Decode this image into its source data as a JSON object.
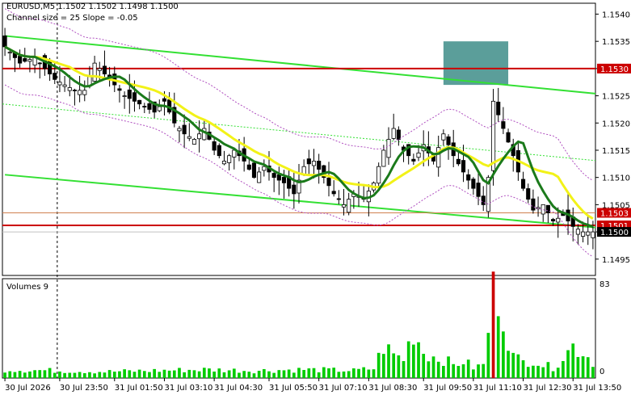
{
  "header": {
    "symbol_line": "EURUSD,M5  1.1502 1.1502 1.1498 1.1500",
    "channel_line": "Channel size = 25 Slope = -0.05"
  },
  "volume_panel": {
    "title": "Volumes 9",
    "scale_max": "83",
    "scale_min": "0"
  },
  "colors": {
    "background": "#ffffff",
    "candle": "#000000",
    "ma_fast": "#1b7a1b",
    "ma_slow": "#f2f218",
    "channel": "#33e033",
    "level_line": "#cc0000",
    "price_box": "#cc0000",
    "box_fill": "#5b9e9a",
    "volume_bar": "#00cc00",
    "volume_bar_hi": "#cc0000"
  },
  "chart_data": {
    "type": "candlestick",
    "symbol": "EURUSD",
    "timeframe": "M5",
    "ylim": [
      1.1492,
      1.1542
    ],
    "y_ticks": [
      "1.1540",
      "1.1535",
      "1.1530",
      "1.1525",
      "1.1520",
      "1.1515",
      "1.1510",
      "1.1505",
      "1.1500",
      "1.1495"
    ],
    "x_ticks": [
      "30 Jul 2026",
      "30 Jul 23:50",
      "31 Jul 01:50",
      "31 Jul 03:10",
      "31 Jul 04:30",
      "31 Jul 05:50",
      "31 Jul 07:10",
      "31 Jul 08:30",
      "31 Jul 09:50",
      "31 Jul 11:10",
      "31 Jul 12:30",
      "31 Jul 13:50"
    ],
    "price_labels": [
      {
        "text": "1.1530",
        "value": 1.153
      },
      {
        "text": "1.1503",
        "value": 1.15035
      },
      {
        "text": "1.1501",
        "value": 1.15012
      },
      {
        "text": "1.1500",
        "value": 1.15
      }
    ],
    "horizontal_levels": [
      1.153,
      1.15012
    ],
    "channel_lines": [
      {
        "from": [
          0,
          1.1536
        ],
        "to": [
          118,
          1.15254
        ]
      },
      {
        "from": [
          0,
          1.15105
        ],
        "to": [
          118,
          1.15008
        ]
      }
    ],
    "box": {
      "from_index": 88,
      "to_index": 101,
      "high": 1.1535,
      "low": 1.1527
    },
    "session_marker_index": 11,
    "close_path": [
      [
        0,
        1.1534
      ],
      [
        3,
        1.1531
      ],
      [
        6,
        1.1532
      ],
      [
        8,
        1.153
      ],
      [
        10,
        1.1528
      ],
      [
        12,
        1.1527
      ],
      [
        14,
        1.1526
      ],
      [
        16,
        1.1526
      ],
      [
        18,
        1.1531
      ],
      [
        20,
        1.1529
      ],
      [
        22,
        1.1527
      ],
      [
        24,
        1.1525
      ],
      [
        26,
        1.1524
      ],
      [
        28,
        1.1523
      ],
      [
        30,
        1.1522
      ],
      [
        32,
        1.1524
      ],
      [
        34,
        1.152
      ],
      [
        36,
        1.1518
      ],
      [
        38,
        1.1517
      ],
      [
        40,
        1.1519
      ],
      [
        42,
        1.1515
      ],
      [
        44,
        1.1513
      ],
      [
        46,
        1.1515
      ],
      [
        48,
        1.1513
      ],
      [
        50,
        1.151
      ],
      [
        52,
        1.1512
      ],
      [
        54,
        1.151
      ],
      [
        56,
        1.1509
      ],
      [
        58,
        1.1507
      ],
      [
        60,
        1.1512
      ],
      [
        62,
        1.1513
      ],
      [
        64,
        1.151
      ],
      [
        66,
        1.1507
      ],
      [
        68,
        1.1505
      ],
      [
        70,
        1.1507
      ],
      [
        72,
        1.1506
      ],
      [
        74,
        1.1509
      ],
      [
        76,
        1.1515
      ],
      [
        78,
        1.1519
      ],
      [
        80,
        1.1515
      ],
      [
        82,
        1.1513
      ],
      [
        84,
        1.1516
      ],
      [
        86,
        1.1513
      ],
      [
        88,
        1.1518
      ],
      [
        90,
        1.1514
      ],
      [
        92,
        1.1511
      ],
      [
        94,
        1.1508
      ],
      [
        96,
        1.1505
      ],
      [
        97,
        1.151
      ],
      [
        98,
        1.1524
      ],
      [
        100,
        1.1519
      ],
      [
        102,
        1.1514
      ],
      [
        104,
        1.1508
      ],
      [
        106,
        1.1504
      ],
      [
        108,
        1.1505
      ],
      [
        110,
        1.1502
      ],
      [
        112,
        1.1503
      ],
      [
        114,
        1.1501
      ],
      [
        116,
        1.15
      ],
      [
        118,
        1.15
      ]
    ],
    "volume_path": [
      [
        0,
        8
      ],
      [
        10,
        7
      ],
      [
        20,
        6
      ],
      [
        30,
        7
      ],
      [
        40,
        8
      ],
      [
        50,
        7
      ],
      [
        60,
        8
      ],
      [
        70,
        7
      ],
      [
        74,
        9
      ],
      [
        76,
        30
      ],
      [
        78,
        22
      ],
      [
        80,
        18
      ],
      [
        82,
        45
      ],
      [
        84,
        25
      ],
      [
        86,
        20
      ],
      [
        88,
        18
      ],
      [
        90,
        12
      ],
      [
        92,
        16
      ],
      [
        94,
        10
      ],
      [
        96,
        12
      ],
      [
        98,
        80
      ],
      [
        99,
        83
      ],
      [
        100,
        60
      ],
      [
        102,
        20
      ],
      [
        104,
        15
      ],
      [
        106,
        18
      ],
      [
        108,
        12
      ],
      [
        110,
        10
      ],
      [
        112,
        20
      ],
      [
        114,
        30
      ],
      [
        116,
        25
      ],
      [
        118,
        15
      ]
    ],
    "series": [
      {
        "style": "candles"
      },
      {
        "style": "moving-average"
      },
      {
        "style": "moving-average"
      }
    ]
  }
}
